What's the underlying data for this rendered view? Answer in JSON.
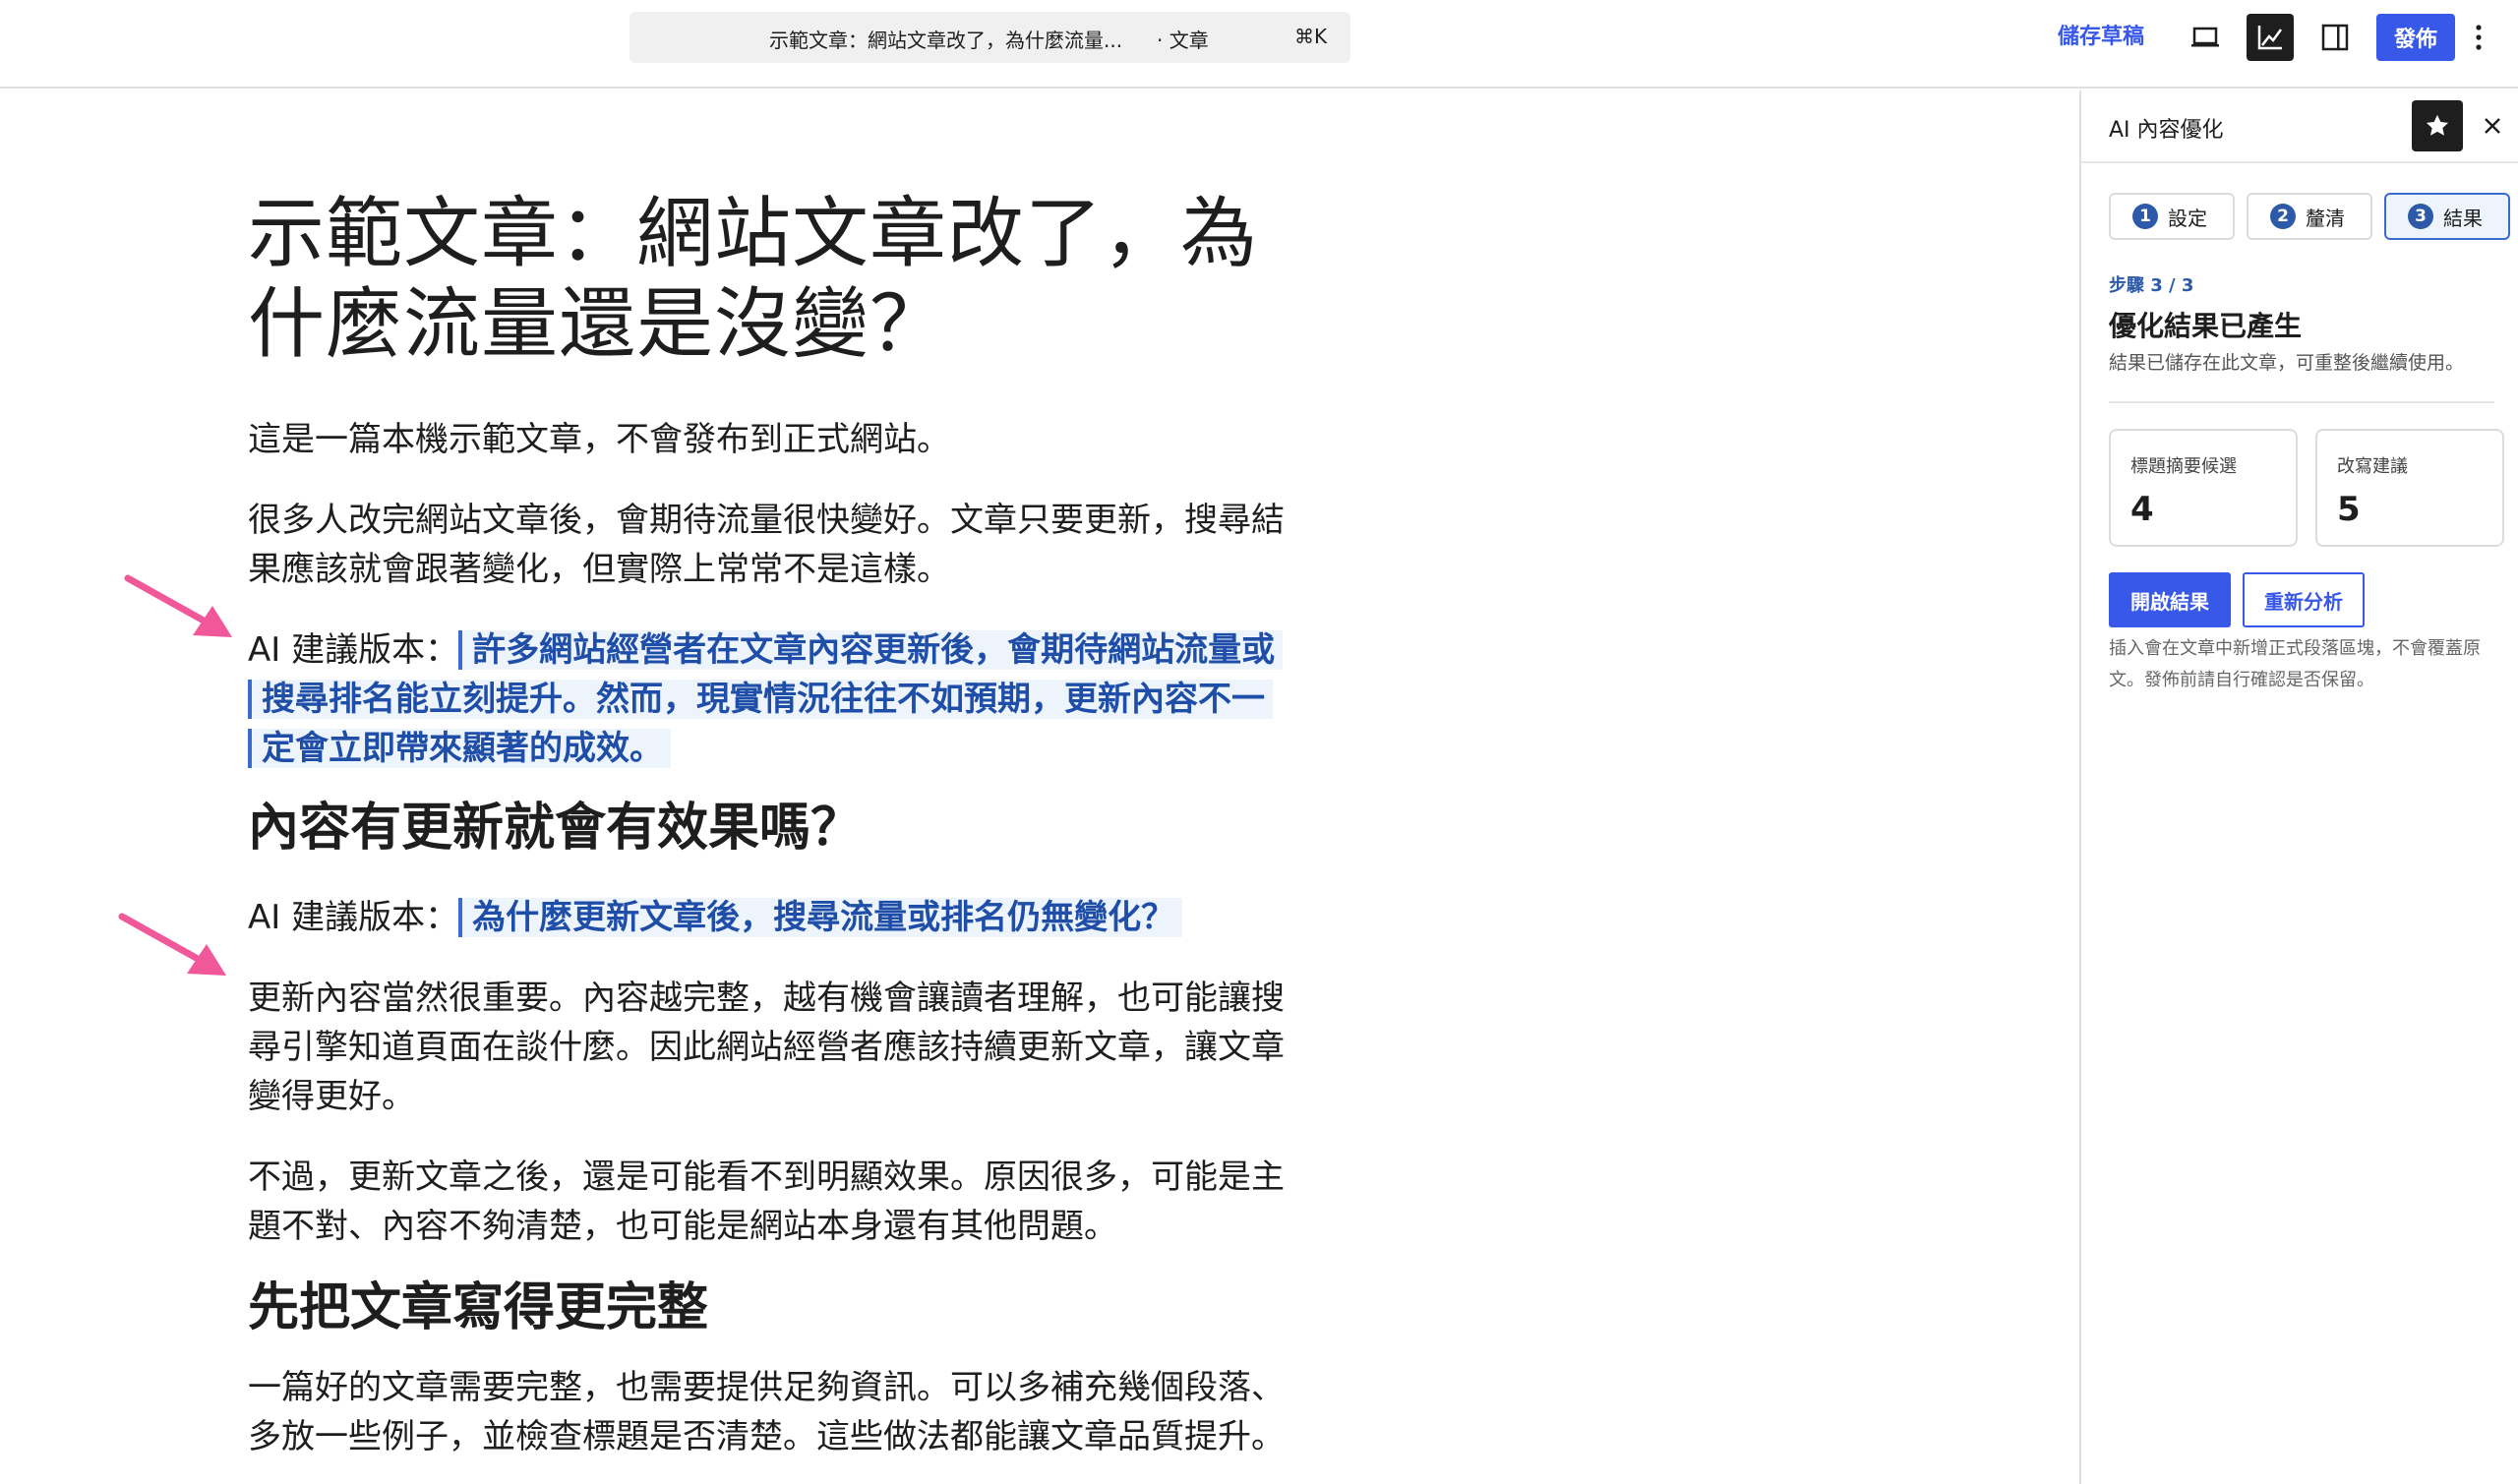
{
  "topbar": {
    "document_title": "示範文章：網站文章改了，為什麼流量...",
    "document_type": "· 文章",
    "shortcut": "⌘K",
    "save_draft_label": "儲存草稿",
    "publish_label": "發佈",
    "icons": [
      "desktop-preview-icon",
      "chart-icon",
      "sidebar-toggle-icon",
      "more-vertical-icon"
    ]
  },
  "post": {
    "title": "示範文章：網站文章改了，為什麼流量還是沒變？",
    "intro": "這是一篇本機示範文章，不會發布到正式網站。",
    "para1": "很多人改完網站文章後，會期待流量很快變好。文章只要更新，搜尋結果應該就會跟著變化，但實際上常常不是這樣。",
    "ai1_label": "AI 建議版本：",
    "ai1_text": "許多網站經營者在文章內容更新後，會期待網站流量或搜尋排名能立刻提升。然而，現實情況往往不如預期，更新內容不一定會立即帶來顯著的成效。",
    "heading1": "內容有更新就會有效果嗎？",
    "ai2_label": "AI 建議版本：",
    "ai2_text": "為什麼更新文章後，搜尋流量或排名仍無變化？",
    "para2": "更新內容當然很重要。內容越完整，越有機會讓讀者理解，也可能讓搜尋引擎知道頁面在談什麼。因此網站經營者應該持續更新文章，讓文章變得更好。",
    "para3": "不過，更新文章之後，還是可能看不到明顯效果。原因很多，可能是主題不對、內容不夠清楚，也可能是網站本身還有其他問題。",
    "heading2": "先把文章寫得更完整",
    "para4": "一篇好的文章需要完整，也需要提供足夠資訊。可以多補充幾個段落、多放一些例子，並檢查標題是否清楚。這些做法都能讓文章品質提升。"
  },
  "sidebar": {
    "title": "AI 內容優化",
    "steps": [
      {
        "num": "1",
        "label": "設定"
      },
      {
        "num": "2",
        "label": "釐清"
      },
      {
        "num": "3",
        "label": "結果"
      }
    ],
    "active_step": "3",
    "step_count": "步驟 3 / 3",
    "result_title": "優化結果已產生",
    "result_desc": "結果已儲存在此文章，可重整後繼續使用。",
    "stats": [
      {
        "label": "標題摘要候選",
        "value": "4"
      },
      {
        "label": "改寫建議",
        "value": "5"
      }
    ],
    "open_results_label": "開啟結果",
    "reanalyze_label": "重新分析",
    "note": "插入會在文章中新增正式段落區塊，不會覆蓋原文。發佈前請自行確認是否保留。"
  },
  "colors": {
    "accent": "#3858e9",
    "highlight_bg": "#eef4fc",
    "highlight_text": "#1f4ea8",
    "arrow": "#f0589a"
  }
}
